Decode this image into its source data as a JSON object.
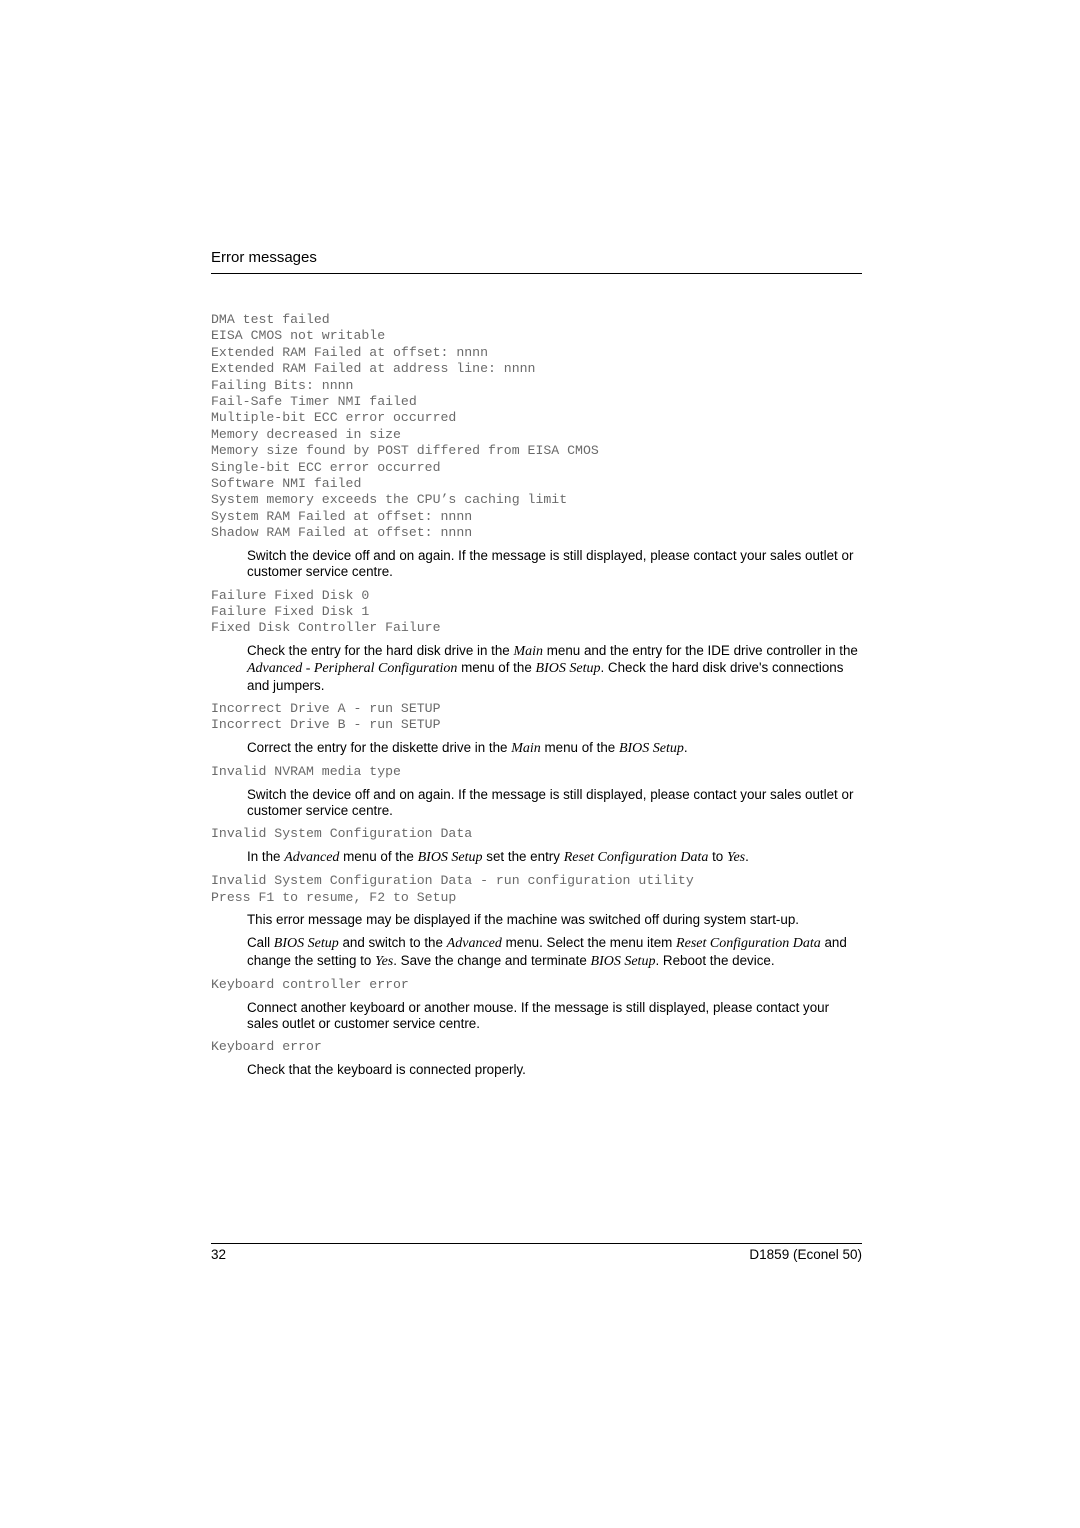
{
  "header": {
    "title": "Error messages"
  },
  "sections": [
    {
      "codes": [
        "DMA test failed",
        "EISA CMOS not writable",
        "Extended RAM Failed at offset: nnnn",
        "Extended RAM Failed at address line: nnnn",
        "Failing Bits: nnnn",
        "Fail-Safe Timer NMI failed",
        "Multiple-bit ECC error occurred",
        "Memory decreased in size",
        "Memory size found by POST differed from EISA CMOS",
        "Single-bit ECC error occurred",
        "Software NMI failed",
        "System memory exceeds the CPU’s caching limit",
        "System RAM Failed at offset: nnnn",
        "Shadow RAM Failed at offset: nnnn"
      ],
      "descriptions": [
        [
          {
            "t": "Switch the device off and on again. If the message is still displayed, please contact your sales outlet or customer service centre."
          }
        ]
      ]
    },
    {
      "codes": [
        "Failure Fixed Disk 0",
        "Failure Fixed Disk 1",
        "Fixed Disk Controller Failure"
      ],
      "descriptions": [
        [
          {
            "t": "Check the entry for the hard disk drive in the "
          },
          {
            "t": "Main",
            "i": true
          },
          {
            "t": " menu and the entry for the IDE drive controller in the "
          },
          {
            "t": "Advanced - Peripheral Configuration",
            "i": true
          },
          {
            "t": " menu of the "
          },
          {
            "t": "BIOS Setup",
            "i": true
          },
          {
            "t": ". Check the hard disk drive's connections and jumpers."
          }
        ]
      ]
    },
    {
      "codes": [
        "Incorrect Drive A - run SETUP",
        "Incorrect Drive B - run SETUP"
      ],
      "descriptions": [
        [
          {
            "t": "Correct the entry for the diskette drive in the "
          },
          {
            "t": "Main",
            "i": true
          },
          {
            "t": " menu of the "
          },
          {
            "t": "BIOS Setup",
            "i": true
          },
          {
            "t": "."
          }
        ]
      ]
    },
    {
      "codes": [
        "Invalid NVRAM media type"
      ],
      "descriptions": [
        [
          {
            "t": "Switch the device off and on again. If the message is still displayed, please contact your sales outlet or customer service centre."
          }
        ]
      ]
    },
    {
      "codes": [
        "Invalid System Configuration Data"
      ],
      "descriptions": [
        [
          {
            "t": "In the "
          },
          {
            "t": "Advanced",
            "i": true
          },
          {
            "t": " menu of the "
          },
          {
            "t": "BIOS Setup",
            "i": true
          },
          {
            "t": " set the entry "
          },
          {
            "t": "Reset Configuration Data",
            "i": true
          },
          {
            "t": " to "
          },
          {
            "t": "Yes",
            "i": true
          },
          {
            "t": "."
          }
        ]
      ]
    },
    {
      "codes": [
        "Invalid System Configuration Data - run configuration utility",
        "Press F1 to resume, F2 to Setup"
      ],
      "descriptions": [
        [
          {
            "t": "This error message may be displayed if the machine was switched off during system start-up."
          }
        ],
        [
          {
            "t": "Call "
          },
          {
            "t": "BIOS Setup",
            "i": true
          },
          {
            "t": " and switch to the "
          },
          {
            "t": "Advanced",
            "i": true
          },
          {
            "t": " menu. Select the menu item "
          },
          {
            "t": "Reset Configuration Data",
            "i": true
          },
          {
            "t": " and change the setting to "
          },
          {
            "t": "Yes",
            "i": true
          },
          {
            "t": ". Save the change and terminate "
          },
          {
            "t": "BIOS Setup",
            "i": true
          },
          {
            "t": ". Reboot the device."
          }
        ]
      ]
    },
    {
      "codes": [
        "Keyboard controller error"
      ],
      "descriptions": [
        [
          {
            "t": "Connect another keyboard or another mouse. If the message is still displayed, please contact your sales outlet or customer service centre."
          }
        ]
      ]
    },
    {
      "codes": [
        "Keyboard error"
      ],
      "descriptions": [
        [
          {
            "t": "Check that the keyboard is connected properly."
          }
        ]
      ]
    }
  ],
  "footer": {
    "page_number": "32",
    "document": "D1859 (Econel 50)"
  }
}
